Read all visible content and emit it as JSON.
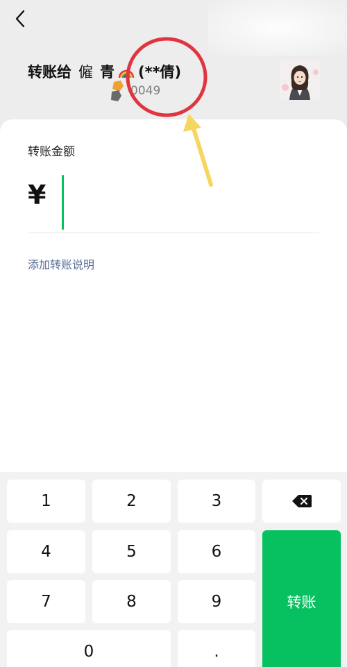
{
  "header": {
    "recipient_prefix": "转账给",
    "recipient_name_part1": "僱",
    "recipient_name_part2": "青",
    "recipient_realname": "(**倩)",
    "account_suffix": "0049"
  },
  "form": {
    "amount_label": "转账金额",
    "currency_symbol": "¥",
    "amount_value": "",
    "add_note_label": "添加转账说明"
  },
  "keypad": {
    "keys": [
      "1",
      "2",
      "3",
      "4",
      "5",
      "6",
      "7",
      "8",
      "9",
      "0",
      "."
    ],
    "transfer_label": "转账"
  },
  "colors": {
    "accent_green": "#07c160",
    "link_blue": "#576b95",
    "annotation_red": "#e0353f",
    "annotation_arrow_yellow": "#f6d65e"
  },
  "icons": {
    "back": "chevron-left-icon",
    "delete": "backspace-icon"
  }
}
